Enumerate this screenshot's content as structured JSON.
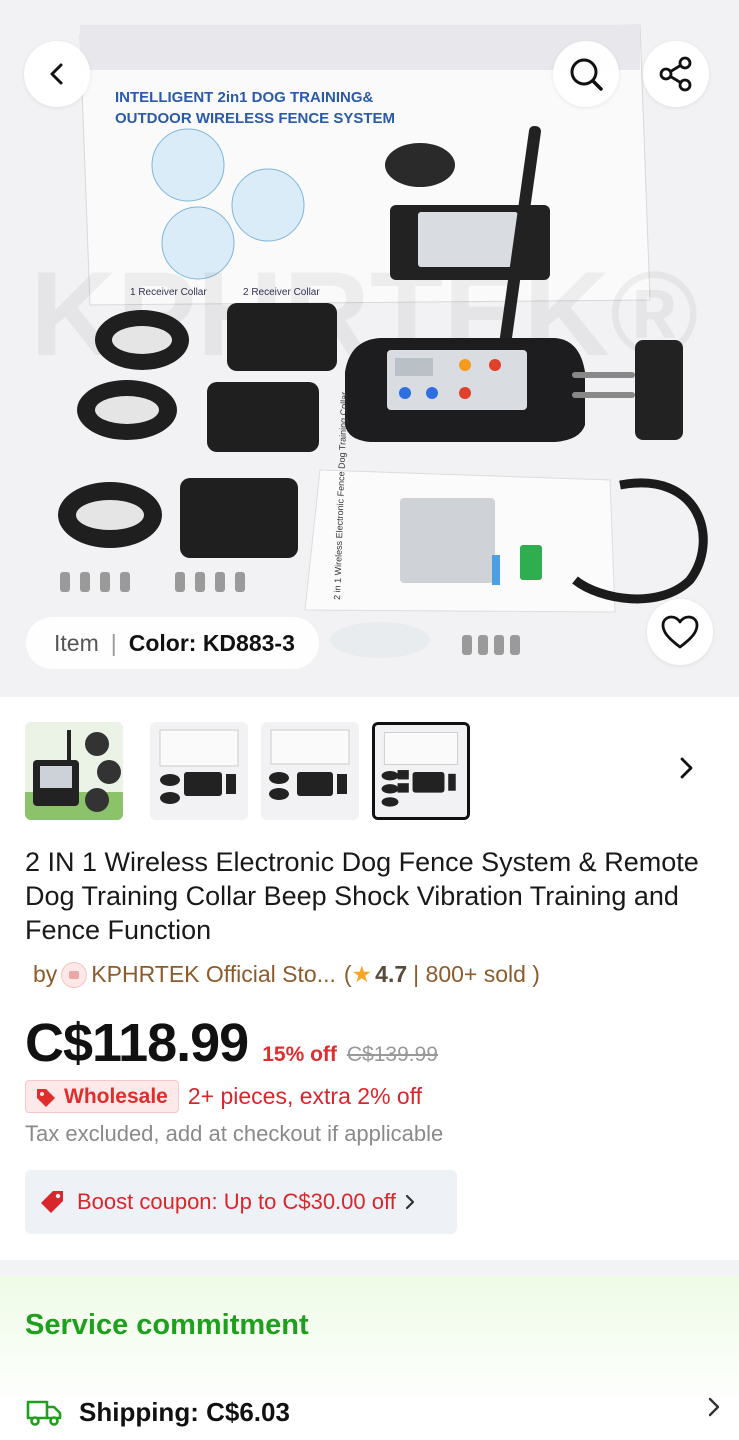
{
  "hero": {
    "box_title_line1": "INTELLIGENT 2in1 DOG TRAINING&",
    "box_title_line2": "OUTDOOR WIRELESS FENCE SYSTEM",
    "box_option1": "1 Receiver Collar",
    "box_option2": "2 Receiver Collar",
    "manual_title": "2 in 1 Wireless Electronic Fence Dog Training Collar",
    "watermark": "KPHRTEK®"
  },
  "sku": {
    "item_label": "Item",
    "separator": "|",
    "color_label": "Color: KD883-3"
  },
  "thumbnails": {
    "count": 4,
    "active_index": 3
  },
  "product": {
    "title": "2 IN 1  Wireless Electronic Dog Fence System & Remote Dog Training Collar  Beep Shock Vibration Training and Fence Function",
    "by": "by",
    "store_name": "KPHRTEK Official Sto...",
    "open_paren": "(",
    "rating": "4.7",
    "sold": "| 800+ sold )"
  },
  "price": {
    "current": "C$118.99",
    "discount": "15% off",
    "original": "C$139.99"
  },
  "wholesale": {
    "badge": "Wholesale",
    "text": "2+ pieces, extra 2% off"
  },
  "tax_note": "Tax excluded, add at checkout if applicable",
  "coupon": {
    "text": "Boost coupon: Up to C$30.00 off"
  },
  "service": {
    "title": "Service commitment",
    "shipping": "Shipping: C$6.03"
  },
  "colors": {
    "price_red": "#e02d2d",
    "service_green": "#1ea01e",
    "store_brown": "#8c5b2c"
  }
}
